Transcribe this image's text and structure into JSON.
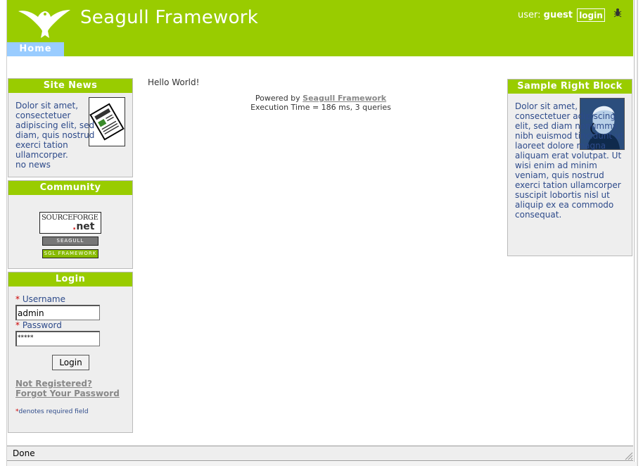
{
  "header": {
    "site_title": "Seagull Framework",
    "user_label": "user:",
    "user_name": "guest",
    "login_link": "login",
    "brand_color": "#99cc00"
  },
  "nav": {
    "tabs": [
      {
        "label": "Home",
        "active": true
      }
    ]
  },
  "left_blocks": {
    "news": {
      "title": "Site News",
      "text": "Dolor sit amet, consectetuer adipiscing elit, sed diam, quis nostrud exerci tation ullamcorper.",
      "empty_text": "no news"
    },
    "community": {
      "title": "Community",
      "badges": [
        "SOURCEFORGE.net",
        "SEAGULL",
        "SGL FRAMEWORK"
      ]
    },
    "login": {
      "title": "Login",
      "username_label": "Username",
      "username_value": "admin",
      "password_label": "Password",
      "password_value": "*****",
      "submit_label": "Login",
      "register_link": "Not Registered?",
      "forgot_link": "Forgot Your Password",
      "required_note": "denotes required field",
      "required_marker": "*"
    }
  },
  "main": {
    "greeting": "Hello World!",
    "powered_by_label": "Powered by",
    "powered_by_link": "Seagull Framework",
    "exec_time": "Execution Time = 186 ms, 3 queries"
  },
  "right_blocks": {
    "sample": {
      "title": "Sample Right Block",
      "text": "Dolor sit amet, consectetuer adipiscing elit, sed diam nonummy nibh euismod tincidunt ut laoreet dolore magna aliquam erat volutpat. Ut wisi enim ad minim veniam, quis nostrud exerci tation ullamcorper suscipit lobortis nisl ut aliquip ex ea commodo consequat."
    }
  },
  "status_bar": {
    "text": "Done"
  }
}
